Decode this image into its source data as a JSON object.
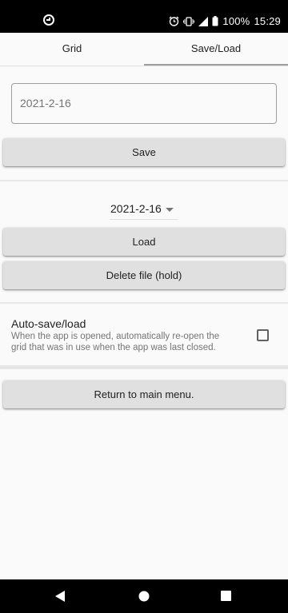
{
  "status_bar": {
    "battery_percent": "100%",
    "time": "15:29"
  },
  "tabs": [
    {
      "label": "Grid",
      "active": false
    },
    {
      "label": "Save/Load",
      "active": true
    }
  ],
  "save_section": {
    "filename_value": "2021-2-16",
    "save_label": "Save"
  },
  "load_section": {
    "selected_file": "2021-2-16",
    "load_label": "Load",
    "delete_label": "Delete file (hold)"
  },
  "autosave": {
    "title": "Auto-save/load",
    "description": "When the app is opened, automatically re-open the grid that was in use when the app was last closed.",
    "checked": false
  },
  "return_label": "Return to main menu.",
  "colors": {
    "button_bg": "#e0e0e0",
    "page_bg": "#fafafa",
    "tab_indicator": "#9e9e9e"
  }
}
